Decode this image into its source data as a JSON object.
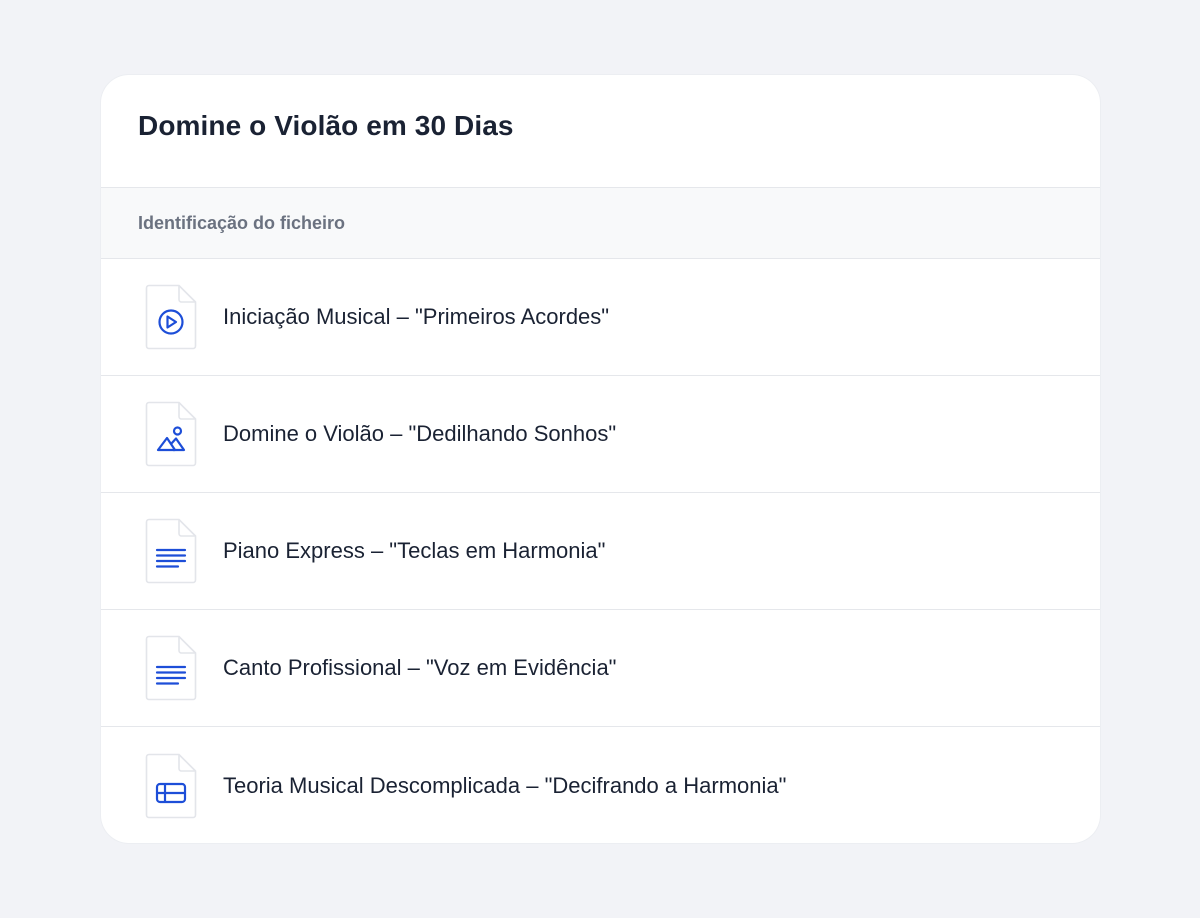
{
  "card": {
    "title": "Domine o Violão em 30 Dias",
    "column_header": "Identificação do ficheiro"
  },
  "files": [
    {
      "name": "Iniciação Musical – \"Primeiros Acordes\"",
      "icon": "video-file-icon"
    },
    {
      "name": "Domine o Violão – \"Dedilhando Sonhos\"",
      "icon": "image-file-icon"
    },
    {
      "name": "Piano Express – \"Teclas em Harmonia\"",
      "icon": "document-file-icon"
    },
    {
      "name": "Canto Profissional – \"Voz em Evidência\"",
      "icon": "document-file-icon"
    },
    {
      "name": "Teoria Musical Descomplicada – \"Decifrando a Harmonia\"",
      "icon": "spreadsheet-file-icon"
    }
  ],
  "colors": {
    "accent": "#1d4ed8",
    "background": "#f2f3f7",
    "card": "#ffffff"
  }
}
